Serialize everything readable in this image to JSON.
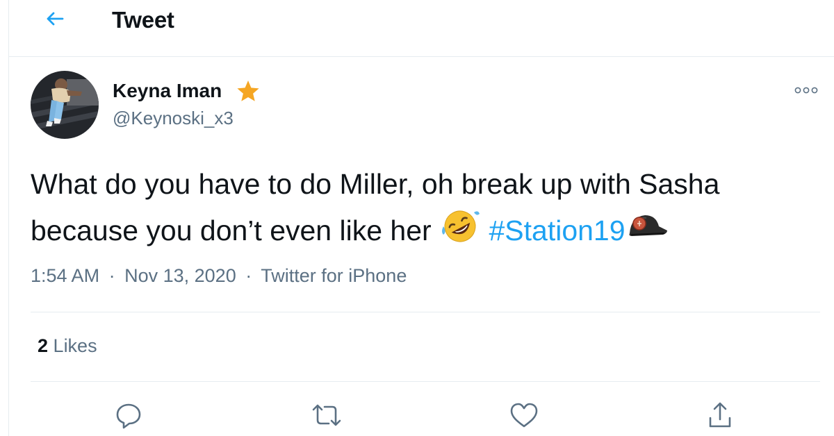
{
  "header": {
    "title": "Tweet",
    "back_icon": "arrow-left-icon"
  },
  "tweet": {
    "author": {
      "display_name": "Keyna Iman",
      "handle": "@Keynoski_x3",
      "badge_icon": "star-icon"
    },
    "text_line1": "What do you have to do Miller, oh break up with Sasha",
    "text_line2": "because you don’t even like her",
    "emoji": "rolling-on-floor-laughing",
    "hashtag": "#Station19",
    "hashtag_emoji": "firefighter-helmet",
    "time": "1:54 AM",
    "date": "Nov 13, 2020",
    "source": "Twitter for iPhone",
    "separator": "·",
    "likes_count": "2",
    "likes_label": "Likes"
  },
  "actions": [
    "reply-icon",
    "retweet-icon",
    "like-icon",
    "share-icon"
  ],
  "colors": {
    "accent": "#1da1f2",
    "text": "#0f1419",
    "secondary": "#5b7083",
    "border": "#e6ecf0",
    "star": "#f5a623"
  }
}
